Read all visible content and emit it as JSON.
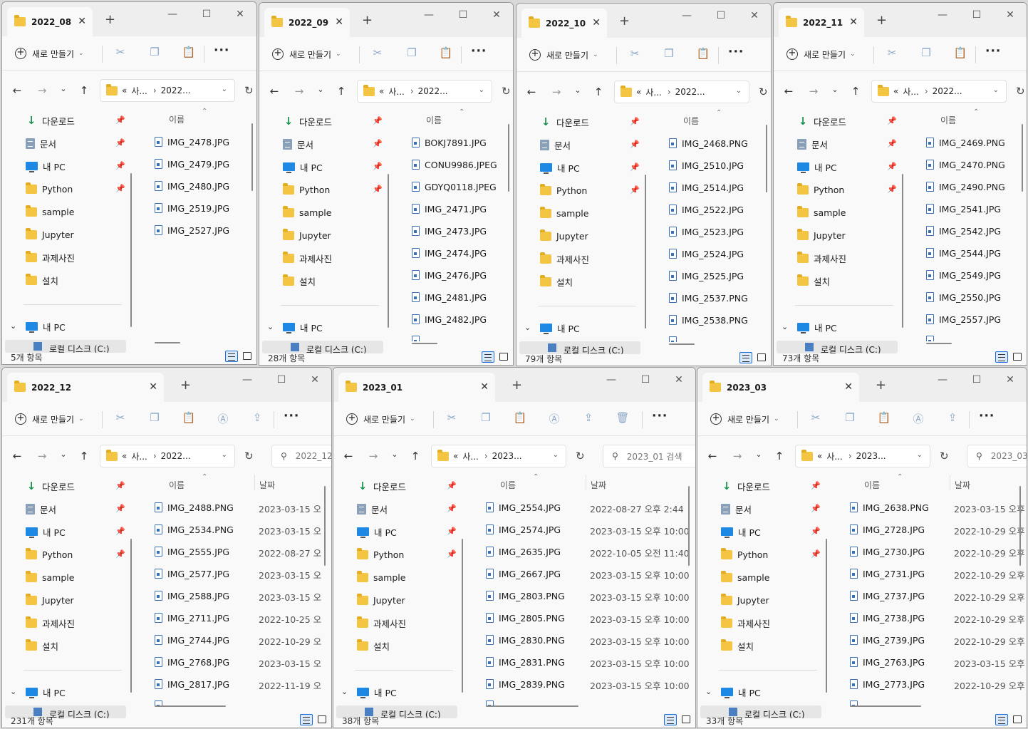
{
  "common": {
    "new_button": "새로 만들기",
    "col_name": "이름",
    "col_date": "날짜",
    "sidebar": [
      "다운로드",
      "문서",
      "내 PC",
      "Python",
      "sample",
      "Jupyter",
      "과제사진",
      "설치"
    ],
    "this_pc": "내 PC",
    "local_disk": "로컬 디스크 (C:)",
    "addr_root": "«",
    "addr_parent": "사..."
  },
  "windows": [
    {
      "title": "2022_08",
      "address": "2022...",
      "status": "5개 항목",
      "files": [
        "IMG_2478.JPG",
        "IMG_2479.JPG",
        "IMG_2480.JPG",
        "IMG_2519.JPG",
        "IMG_2527.JPG"
      ]
    },
    {
      "title": "2022_09",
      "address": "2022...",
      "status": "28개 항목",
      "files": [
        "BOKJ7891.JPG",
        "CONU9986.JPEG",
        "GDYQ0118.JPEG",
        "IMG_2471.JPG",
        "IMG_2473.JPG",
        "IMG_2474.JPG",
        "IMG_2476.JPG",
        "IMG_2481.JPG",
        "IMG_2482.JPG"
      ]
    },
    {
      "title": "2022_10",
      "address": "2022...",
      "status": "79개 항목",
      "files": [
        "IMG_2468.PNG",
        "IMG_2510.JPG",
        "IMG_2514.JPG",
        "IMG_2522.JPG",
        "IMG_2523.JPG",
        "IMG_2524.JPG",
        "IMG_2525.JPG",
        "IMG_2537.PNG",
        "IMG_2538.PNG"
      ]
    },
    {
      "title": "2022_11",
      "address": "2022...",
      "status": "73개 항목",
      "files": [
        "IMG_2469.PNG",
        "IMG_2470.PNG",
        "IMG_2490.PNG",
        "IMG_2541.JPG",
        "IMG_2542.JPG",
        "IMG_2544.JPG",
        "IMG_2549.JPG",
        "IMG_2550.JPG",
        "IMG_2557.JPG"
      ]
    },
    {
      "title": "2022_12",
      "address": "2022...",
      "search_placeholder": "2022_12",
      "status": "231개 항목",
      "files": [
        "IMG_2488.PNG",
        "IMG_2534.PNG",
        "IMG_2555.JPG",
        "IMG_2577.JPG",
        "IMG_2588.JPG",
        "IMG_2711.JPG",
        "IMG_2744.JPG",
        "IMG_2768.JPG",
        "IMG_2817.JPG"
      ],
      "dates": [
        "2023-03-15 오",
        "2023-03-15 오",
        "2022-08-27 오",
        "2023-03-15 오",
        "2023-03-15 오",
        "2022-10-25 오",
        "2022-10-29 오",
        "2023-03-15 오",
        "2022-11-19 오"
      ]
    },
    {
      "title": "2023_01",
      "address": "2023...",
      "search_placeholder": "2023_01 검색",
      "status": "38개 항목",
      "files": [
        "IMG_2554.JPG",
        "IMG_2574.JPG",
        "IMG_2635.JPG",
        "IMG_2667.JPG",
        "IMG_2803.PNG",
        "IMG_2805.PNG",
        "IMG_2830.PNG",
        "IMG_2831.PNG",
        "IMG_2839.PNG"
      ],
      "dates": [
        "2022-08-27 오후 2:44",
        "2023-03-15 오후 10:00",
        "2022-10-05 오전 11:40",
        "2023-03-15 오후 10:00",
        "2023-03-15 오후 10:00",
        "2023-03-15 오후 10:00",
        "2023-03-15 오후 10:00",
        "2023-03-15 오후 10:00",
        "2023-03-15 오후 10:00"
      ]
    },
    {
      "title": "2023_03",
      "address": "2023...",
      "search_placeholder": "2023_03",
      "status": "33개 항목",
      "files": [
        "IMG_2638.PNG",
        "IMG_2728.JPG",
        "IMG_2730.JPG",
        "IMG_2731.JPG",
        "IMG_2737.JPG",
        "IMG_2738.JPG",
        "IMG_2739.JPG",
        "IMG_2763.JPG",
        "IMG_2773.JPG"
      ],
      "dates": [
        "2023-03-15 오후",
        "2022-10-29 오후",
        "2022-10-29 오후",
        "2022-10-29 오후",
        "2022-10-29 오후",
        "2022-10-29 오후",
        "2022-10-29 오후",
        "2023-03-15 오후",
        "2022-10-29 오후"
      ]
    }
  ]
}
